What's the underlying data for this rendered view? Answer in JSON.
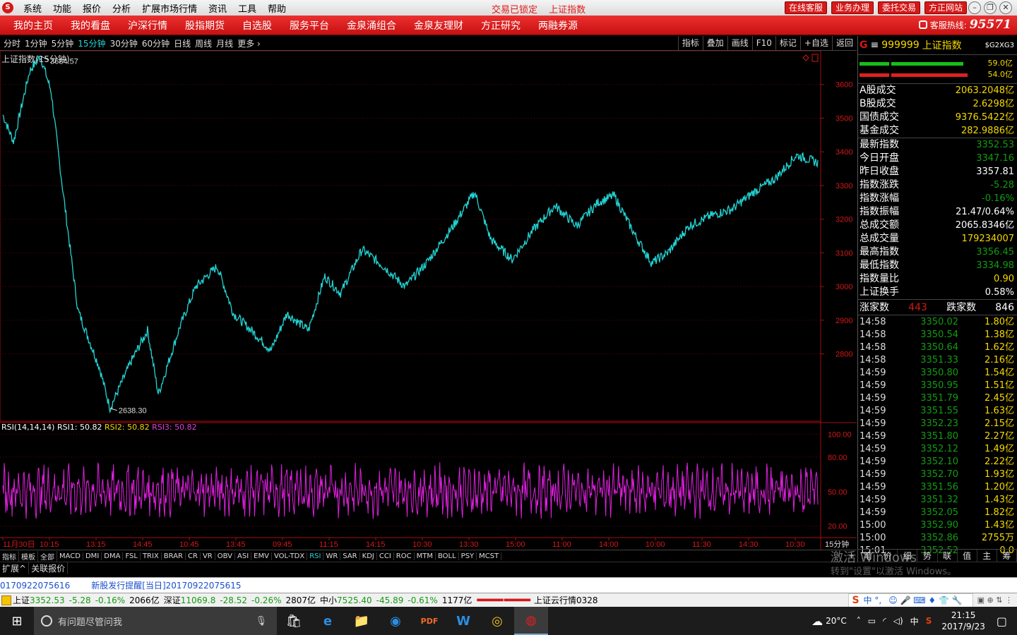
{
  "titlebar": {
    "menus": [
      "系统",
      "功能",
      "报价",
      "分析",
      "扩展市场行情",
      "资讯",
      "工具",
      "帮助"
    ],
    "status1": "交易已锁定",
    "status2": "上证指数",
    "buttons": [
      "在线客服",
      "业务办理",
      "委托交易",
      "方正网站"
    ]
  },
  "nav": {
    "items": [
      "我的主页",
      "我的看盘",
      "沪深行情",
      "股指期货",
      "自选股",
      "服务平台",
      "金泉涌组合",
      "金泉友理财",
      "方正研究",
      "两融券源"
    ],
    "hotline_label": "客服热线:",
    "hotline": "95571"
  },
  "periods": {
    "items": [
      "分时",
      "1分钟",
      "5分钟",
      "15分钟",
      "30分钟",
      "60分钟",
      "日线",
      "周线",
      "月线",
      "更多 ›"
    ],
    "active": 3
  },
  "tools": [
    "指标",
    "叠加",
    "画线",
    "F10",
    "标记",
    "+自选",
    "返回"
  ],
  "chart": {
    "title": "上证指数(15分钟)",
    "rsi_label": "RSI(14,14,14)",
    "rsi1": "RSI1: 50.82",
    "rsi2": "RSI2: 50.82",
    "rsi3": "RSI3: 50.82"
  },
  "chart_data": {
    "type": "line",
    "price": {
      "ylim": [
        2600,
        3700
      ],
      "ticks": [
        3600,
        3500,
        3400,
        3300,
        3200,
        3100,
        3000,
        2900,
        2800
      ],
      "high_label": "3684.57",
      "low_label": "2638.30",
      "key": [
        [
          0,
          3510
        ],
        [
          2,
          3430
        ],
        [
          5,
          3640
        ],
        [
          7,
          3684.57
        ],
        [
          9,
          3580
        ],
        [
          11,
          3310
        ],
        [
          14,
          2930
        ],
        [
          18,
          2760
        ],
        [
          20,
          2638.3
        ],
        [
          24,
          2780
        ],
        [
          27,
          2870
        ],
        [
          29,
          2680
        ],
        [
          33,
          2880
        ],
        [
          36,
          3000
        ],
        [
          40,
          3060
        ],
        [
          43,
          2920
        ],
        [
          47,
          2860
        ],
        [
          50,
          2810
        ],
        [
          53,
          2920
        ],
        [
          57,
          2870
        ],
        [
          60,
          3030
        ],
        [
          63,
          2980
        ],
        [
          67,
          3110
        ],
        [
          71,
          3060
        ],
        [
          75,
          3000
        ],
        [
          79,
          3070
        ],
        [
          84,
          3180
        ],
        [
          88,
          3280
        ],
        [
          91,
          3140
        ],
        [
          95,
          3080
        ],
        [
          99,
          3170
        ],
        [
          103,
          3240
        ],
        [
          107,
          3180
        ],
        [
          111,
          3250
        ],
        [
          114,
          3270
        ],
        [
          118,
          3150
        ],
        [
          121,
          3070
        ],
        [
          124,
          3100
        ],
        [
          128,
          3180
        ],
        [
          132,
          3210
        ],
        [
          136,
          3230
        ],
        [
          140,
          3280
        ],
        [
          144,
          3320
        ],
        [
          148,
          3390
        ],
        [
          152,
          3368
        ]
      ]
    },
    "rsi": {
      "ylim": [
        10,
        110
      ],
      "ticks": [
        100,
        80,
        50,
        20
      ],
      "base": 50.82,
      "amp": 18
    },
    "time_labels": [
      "11月30日",
      "10:15",
      "13:15",
      "14:45",
      "10:45",
      "13:45",
      "09:45",
      "11:15",
      "14:15",
      "10:30",
      "13:30",
      "15:00",
      "11:00",
      "14:00",
      "10:00",
      "11:30",
      "14:30",
      "10:30"
    ]
  },
  "bottom_tabs": [
    "指标",
    "模板",
    "全部",
    "MACD",
    "DMI",
    "DMA",
    "FSL",
    "TRIX",
    "BRAR",
    "CR",
    "VR",
    "OBV",
    "ASI",
    "EMV",
    "VOL-TDX",
    "RSI",
    "WR",
    "SAR",
    "KDJ",
    "CCI",
    "ROC",
    "MTM",
    "BOLL",
    "PSY",
    "MCST"
  ],
  "bottom_tab_active": "RSI",
  "bottom_tab_right": "15分钟",
  "bottom2": [
    "扩展^",
    "关联报价"
  ],
  "right_panel": {
    "code": "999999",
    "name": "上证指数",
    "tag": "$G2XG3",
    "bar1": "59.0亿",
    "bar2": "54.0亿",
    "rows1": [
      [
        "A股成交",
        "2063.2048亿"
      ],
      [
        "B股成交",
        "2.6298亿"
      ],
      [
        "国债成交",
        "9376.5422亿"
      ],
      [
        "基金成交",
        "282.9886亿"
      ]
    ],
    "rows2": [
      [
        "最新指数",
        "3352.53",
        "dn"
      ],
      [
        "今日开盘",
        "3347.16",
        "dn"
      ],
      [
        "昨日收盘",
        "3357.81",
        "wh"
      ],
      [
        "指数涨跌",
        "-5.28",
        "dn"
      ],
      [
        "指数涨幅",
        "-0.16%",
        "dn"
      ],
      [
        "指数振幅",
        "21.47/0.64%",
        "wh"
      ],
      [
        "总成交额",
        "2065.8346亿",
        "wh"
      ],
      [
        "总成交量",
        "179234007",
        "yl"
      ],
      [
        "最高指数",
        "3356.45",
        "dn"
      ],
      [
        "最低指数",
        "3334.98",
        "dn"
      ],
      [
        "指数量比",
        "0.90",
        "yl"
      ],
      [
        "上证换手",
        "0.58%",
        "wh"
      ]
    ],
    "up_label": "涨家数",
    "up": "443",
    "down_label": "跌家数",
    "down": "846",
    "ticks": [
      [
        "14:58",
        "3350.02",
        "1.80亿"
      ],
      [
        "14:58",
        "3350.54",
        "1.38亿"
      ],
      [
        "14:58",
        "3350.64",
        "1.62亿"
      ],
      [
        "14:58",
        "3351.33",
        "2.16亿"
      ],
      [
        "14:59",
        "3350.80",
        "1.54亿"
      ],
      [
        "14:59",
        "3350.95",
        "1.51亿"
      ],
      [
        "14:59",
        "3351.79",
        "2.45亿"
      ],
      [
        "14:59",
        "3351.55",
        "1.63亿"
      ],
      [
        "14:59",
        "3352.23",
        "2.15亿"
      ],
      [
        "14:59",
        "3351.80",
        "2.27亿"
      ],
      [
        "14:59",
        "3352.12",
        "1.49亿"
      ],
      [
        "14:59",
        "3352.10",
        "2.22亿"
      ],
      [
        "14:59",
        "3352.70",
        "1.93亿"
      ],
      [
        "14:59",
        "3351.56",
        "1.20亿"
      ],
      [
        "14:59",
        "3351.32",
        "1.43亿"
      ],
      [
        "14:59",
        "3352.05",
        "1.82亿"
      ],
      [
        "15:00",
        "3352.90",
        "1.43亿"
      ],
      [
        "15:00",
        "3352.86",
        "2755万"
      ],
      [
        "15:01",
        "3352.52",
        "0.0"
      ]
    ],
    "bottom_tabs": [
      "笔",
      "价",
      "细",
      "势",
      "联",
      "值",
      "主",
      "筹"
    ]
  },
  "ticker": {
    "text1": "0170922075616",
    "text2": "新股发行提醒[当日]20170922075615"
  },
  "status": {
    "sh_label": "上证",
    "sh": "3352.53",
    "sh_chg": "-5.28",
    "sh_pct": "-0.16%",
    "sh_amt": "2066亿",
    "sz_label": "深证",
    "sz": "11069.8",
    "sz_chg": "-28.52",
    "sz_pct": "-0.26%",
    "sz_amt": "2807亿",
    "zx_label": "中小",
    "zx": "7525.40",
    "zx_chg": "-45.89",
    "zx_pct": "-0.61%",
    "zx_amt": "1177亿",
    "cloud": "上证云行情0328"
  },
  "taskbar": {
    "search": "有问题尽管问我",
    "temp": "20°C",
    "ime": "中",
    "time": "21:15",
    "date": "2017/9/23"
  },
  "watermark": {
    "line1": "激活 Windows",
    "line2": "转到\"设置\"以激活 Windows。"
  }
}
